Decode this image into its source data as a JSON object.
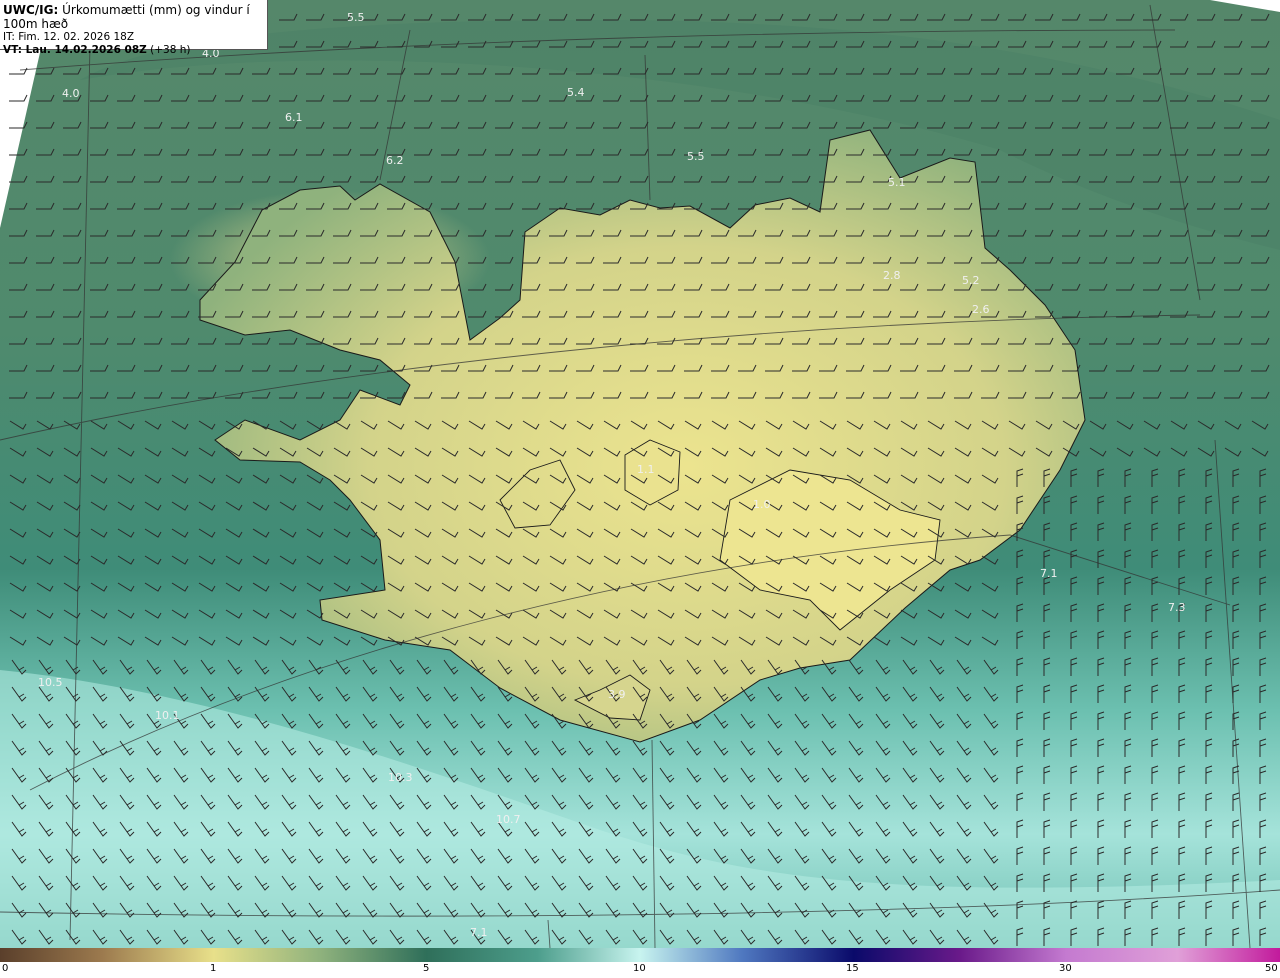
{
  "header": {
    "product": "UWC/IG:",
    "description": "Úrkomumætti (mm) og vindur í 100m hæð",
    "it_line": "IT: Fim. 12. 02. 2026 18Z",
    "vt_label": "VT: Lau. 14.02.2026 08Z",
    "vt_offset": "(+38 h)"
  },
  "colorbar": {
    "ticks": [
      "0",
      "1",
      "5",
      "10",
      "15",
      "30",
      "50"
    ]
  },
  "map_labels": [
    "5.5",
    "4.0",
    "4.0",
    "6.1",
    "6.2",
    "5.4",
    "5.5",
    "5.1",
    "2.8",
    "5.2",
    "2.6",
    "1.1",
    "1.0",
    "7.1",
    "7.3",
    "3.9",
    "10.3",
    "10.7",
    "7.1",
    "10.5",
    "10.1"
  ],
  "colors": {
    "land_yellow": "#e6e08c",
    "sea_green": "#3f7f6a",
    "sea_cyan": "#a9e6df",
    "coast": "#1a1a1a"
  }
}
